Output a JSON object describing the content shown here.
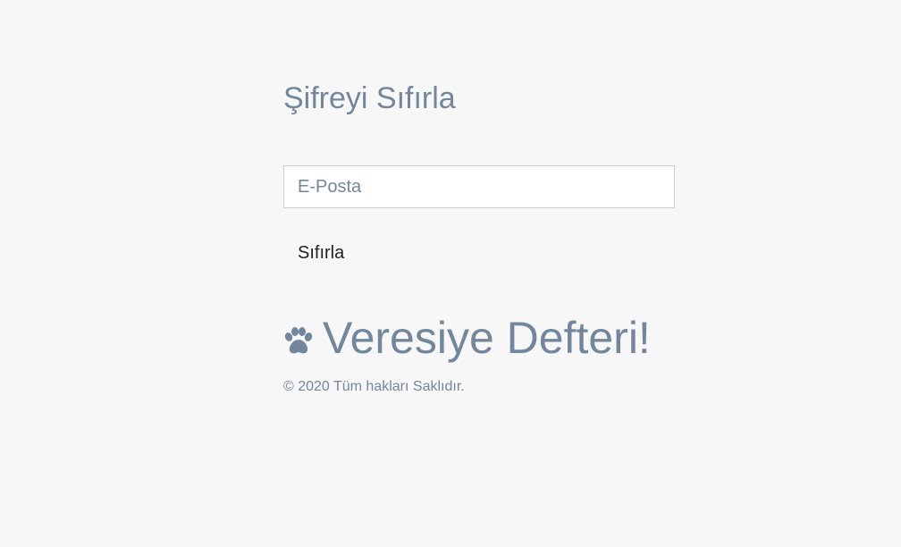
{
  "form": {
    "title": "Şifreyi Sıfırla",
    "email_placeholder": "E-Posta",
    "reset_label": "Sıfırla"
  },
  "brand": {
    "name": "Veresiye Defteri!",
    "icon": "paw-icon"
  },
  "footer": {
    "copyright": "© 2020 Tüm hakları Saklıdır."
  },
  "colors": {
    "background": "#f7f7f7",
    "text_muted": "#73879c",
    "input_border": "#cccccc",
    "input_background": "#ffffff",
    "button_text": "#222222"
  }
}
